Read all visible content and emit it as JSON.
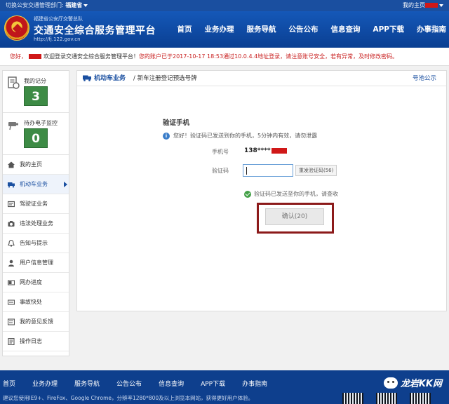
{
  "topstrip": {
    "dept_prefix": "切换公安交通管理部门: ",
    "dept_name": "福建省",
    "user_label": "我的主页"
  },
  "header": {
    "subtitle": "福建省公安厅交警总队",
    "title": "交通安全综合服务管理平台",
    "url": "http://fj.122.gov.cn",
    "nav": [
      "首页",
      "业务办理",
      "服务导航",
      "公告公布",
      "信息查询",
      "APP下载",
      "办事指南"
    ]
  },
  "welcome": {
    "greeting": "您好，",
    "text": "欢迎登录交通安全综合服务管理平台！",
    "warning": "您的账户已于2017-10-17 18:53通过10.0.4.4地址登录，请注意账号安全，若有异常，及时修改密码。"
  },
  "sidebar": {
    "score_label": "我的记分",
    "score_value": "3",
    "monitor_label": "待办电子监控",
    "monitor_value": "0",
    "items": [
      {
        "label": "我的主页",
        "icon": "home-icon"
      },
      {
        "label": "机动车业务",
        "icon": "car-icon"
      },
      {
        "label": "驾驶证业务",
        "icon": "license-icon"
      },
      {
        "label": "违法处理业务",
        "icon": "camera-icon"
      },
      {
        "label": "告知与提示",
        "icon": "bell-icon"
      },
      {
        "label": "用户信息管理",
        "icon": "user-icon"
      },
      {
        "label": "网办进度",
        "icon": "progress-icon"
      },
      {
        "label": "事故快处",
        "icon": "accident-icon"
      },
      {
        "label": "我的意见反馈",
        "icon": "feedback-icon"
      },
      {
        "label": "操作日志",
        "icon": "log-icon"
      }
    ]
  },
  "main": {
    "breadcrumb_section": "机动车业务",
    "breadcrumb_page": "/ 新车注册登记预选号牌",
    "notice_link": "号池公示",
    "verify_title": "验证手机",
    "info_text": "您好！验证码已发送到你的手机，5分钟内有效，请勿泄露",
    "phone_label": "手机号",
    "phone_value": "138****",
    "code_label": "验证码",
    "code_value": "",
    "resend_label": "重发验证码(56)",
    "sent_msg": "验证码已发送至你的手机，请查收",
    "confirm_label": "确认(20)"
  },
  "footer": {
    "nav": [
      "首页",
      "业务办理",
      "服务导航",
      "公告公布",
      "信息查询",
      "APP下载",
      "办事指南"
    ],
    "note": "建议您使用IE9+、FireFox、Google Chrome，分辨率1280*800及以上浏览本网站，获得更好用户体验。",
    "watermark": "龙岩KK网"
  }
}
